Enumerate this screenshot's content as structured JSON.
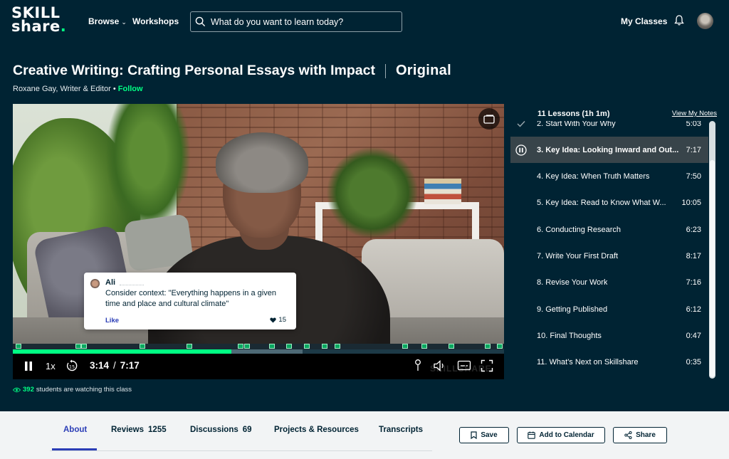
{
  "header": {
    "logo_line1": "SKILL",
    "logo_line2": "share",
    "logo_dot": ".",
    "browse": "Browse",
    "workshops": "Workshops",
    "search_placeholder": "What do you want to learn today?",
    "my_classes": "My Classes"
  },
  "class": {
    "title": "Creative Writing: Crafting Personal Essays with Impact",
    "badge": "Original",
    "teacher": "Roxane Gay, Writer & Editor",
    "bullet": "•",
    "follow": "Follow"
  },
  "video": {
    "note": {
      "author": "Ali",
      "text": "Consider context: \"Everything happens in a given time and place and cultural climate\"",
      "like": "Like",
      "likes": "15"
    },
    "speed": "1x",
    "current_time": "3:14",
    "time_sep": "/",
    "duration": "7:17",
    "watermark": "SKILLSHARE",
    "progress_fraction": 0.445,
    "buffer_fraction": 0.59
  },
  "watchers": {
    "count": "392",
    "text": "students are watching this class"
  },
  "lessons": {
    "header": "11 Lessons (1h 1m)",
    "notes_link": "View My Notes",
    "items": [
      {
        "name": "2. Start With Your Why",
        "duration": "5:03",
        "state": "completed"
      },
      {
        "name": "3. Key Idea: Looking Inward and Out...",
        "duration": "7:17",
        "state": "playing"
      },
      {
        "name": "4. Key Idea: When Truth Matters",
        "duration": "7:50",
        "state": "none"
      },
      {
        "name": "5. Key Idea: Read to Know What W...",
        "duration": "10:05",
        "state": "none"
      },
      {
        "name": "6. Conducting Research",
        "duration": "6:23",
        "state": "none"
      },
      {
        "name": "7. Write Your First Draft",
        "duration": "8:17",
        "state": "none"
      },
      {
        "name": "8. Revise Your Work",
        "duration": "7:16",
        "state": "none"
      },
      {
        "name": "9. Getting Published",
        "duration": "6:12",
        "state": "none"
      },
      {
        "name": "10. Final Thoughts",
        "duration": "0:47",
        "state": "none"
      },
      {
        "name": "11. What's Next on Skillshare",
        "duration": "0:35",
        "state": "none"
      }
    ]
  },
  "tabs": [
    {
      "label": "About",
      "count": ""
    },
    {
      "label": "Reviews",
      "count": "1255"
    },
    {
      "label": "Discussions",
      "count": "69"
    },
    {
      "label": "Projects & Resources",
      "count": ""
    },
    {
      "label": "Transcripts",
      "count": ""
    }
  ],
  "actions": {
    "save": "Save",
    "calendar": "Add to Calendar",
    "share": "Share"
  },
  "colors": {
    "background": "#002333",
    "accent_green": "#00ff84",
    "tab_active": "#2b3db6"
  }
}
